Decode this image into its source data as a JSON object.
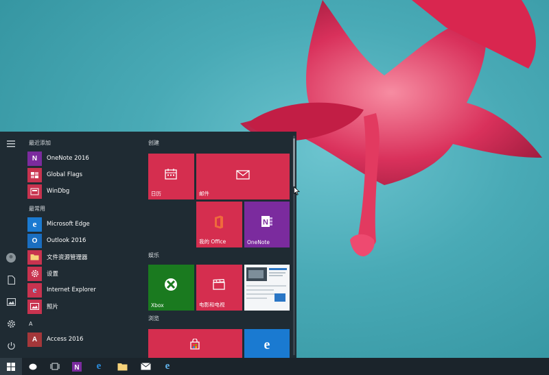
{
  "colors": {
    "menu_bg": "#1f2b33",
    "tile_red": "#d52e4f",
    "tile_purple": "#7b2b9e",
    "tile_green": "#1a7a1f",
    "tile_blue": "#1a7ad1",
    "taskbar_bg": "#1b242b",
    "accent": "#2a76c5"
  },
  "sections": {
    "recent": "最近添加",
    "frequent": "最常用",
    "letter_a": "A"
  },
  "recent_apps": [
    {
      "label": "OneNote 2016",
      "icon": "onenote-icon"
    },
    {
      "label": "Global Flags",
      "icon": "global-flags-icon"
    },
    {
      "label": "WinDbg",
      "icon": "windbg-icon"
    }
  ],
  "frequent_apps": [
    {
      "label": "Microsoft Edge",
      "icon": "edge-icon"
    },
    {
      "label": "Outlook 2016",
      "icon": "outlook-icon"
    },
    {
      "label": "文件资源管理器",
      "icon": "file-explorer-icon"
    },
    {
      "label": "设置",
      "icon": "settings-icon"
    },
    {
      "label": "Internet Explorer",
      "icon": "ie-icon"
    },
    {
      "label": "照片",
      "icon": "photos-icon"
    }
  ],
  "a_apps": [
    {
      "label": "Access 2016",
      "icon": "access-icon"
    }
  ],
  "tile_groups": {
    "create": "创建",
    "play": "娱乐",
    "explore": "浏览"
  },
  "tiles": {
    "calendar": "日历",
    "mail": "邮件",
    "office": "我的 Office",
    "onenote": "OneNote",
    "xbox": "Xbox",
    "movies": "电影和电视"
  }
}
